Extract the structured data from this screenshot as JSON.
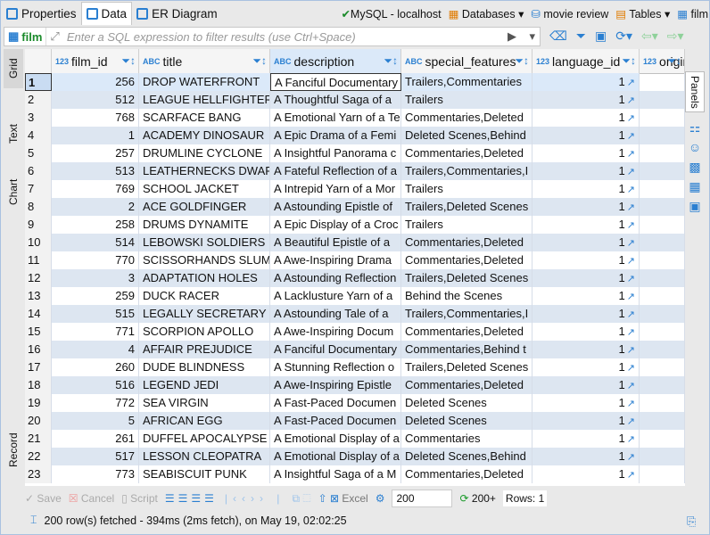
{
  "tabs": [
    {
      "label": "Properties"
    },
    {
      "label": "Data",
      "active": true
    },
    {
      "label": "ER Diagram"
    }
  ],
  "breadcrumb": {
    "connection": "MySQL - localhost",
    "databases": "Databases",
    "database": "movie review",
    "tables": "Tables",
    "table": "film"
  },
  "filter": {
    "table": "film",
    "placeholder": "Enter a SQL expression to filter results (use Ctrl+Space)"
  },
  "side_tabs": {
    "grid": "Grid",
    "text": "Text",
    "chart": "Chart",
    "record": "Record",
    "panels": "Panels"
  },
  "columns": [
    {
      "name": "film_id",
      "type": "123"
    },
    {
      "name": "title",
      "type": "ABC"
    },
    {
      "name": "description",
      "type": "ABC"
    },
    {
      "name": "special_features",
      "type": "ABC"
    },
    {
      "name": "language_id",
      "type": "123"
    },
    {
      "name": "original_language_id",
      "type": "123"
    }
  ],
  "rows": [
    [
      "1",
      "256",
      "DROP WATERFRONT",
      "A Fanciful Documentary",
      "Trailers,Commentaries",
      "1"
    ],
    [
      "2",
      "512",
      "LEAGUE HELLFIGHTERS",
      "A Thoughtful Saga of a",
      "Trailers",
      "1"
    ],
    [
      "3",
      "768",
      "SCARFACE BANG",
      "A Emotional Yarn of a Te",
      "Commentaries,Deleted",
      "1"
    ],
    [
      "4",
      "1",
      "ACADEMY DINOSAUR",
      "A Epic Drama of a Femi",
      "Deleted Scenes,Behind",
      "1"
    ],
    [
      "5",
      "257",
      "DRUMLINE CYCLONE",
      "A Insightful Panorama c",
      "Commentaries,Deleted",
      "1"
    ],
    [
      "6",
      "513",
      "LEATHERNECKS DWARFS",
      "A Fateful Reflection of a",
      "Trailers,Commentaries,I",
      "1"
    ],
    [
      "7",
      "769",
      "SCHOOL JACKET",
      "A Intrepid Yarn of a Mor",
      "Trailers",
      "1"
    ],
    [
      "8",
      "2",
      "ACE GOLDFINGER",
      "A Astounding Epistle of",
      "Trailers,Deleted Scenes",
      "1"
    ],
    [
      "9",
      "258",
      "DRUMS DYNAMITE",
      "A Epic Display of a Croc",
      "Trailers",
      "1"
    ],
    [
      "10",
      "514",
      "LEBOWSKI SOLDIERS",
      "A Beautiful Epistle of a",
      "Commentaries,Deleted",
      "1"
    ],
    [
      "11",
      "770",
      "SCISSORHANDS SLUM",
      "A Awe-Inspiring Drama",
      "Commentaries,Deleted",
      "1"
    ],
    [
      "12",
      "3",
      "ADAPTATION HOLES",
      "A Astounding Reflection",
      "Trailers,Deleted Scenes",
      "1"
    ],
    [
      "13",
      "259",
      "DUCK RACER",
      "A Lacklusture Yarn of a",
      "Behind the Scenes",
      "1"
    ],
    [
      "14",
      "515",
      "LEGALLY SECRETARY",
      "A Astounding Tale of a",
      "Trailers,Commentaries,I",
      "1"
    ],
    [
      "15",
      "771",
      "SCORPION APOLLO",
      "A Awe-Inspiring Docum",
      "Commentaries,Deleted",
      "1"
    ],
    [
      "16",
      "4",
      "AFFAIR PREJUDICE",
      "A Fanciful Documentary",
      "Commentaries,Behind t",
      "1"
    ],
    [
      "17",
      "260",
      "DUDE BLINDNESS",
      "A Stunning Reflection o",
      "Trailers,Deleted Scenes",
      "1"
    ],
    [
      "18",
      "516",
      "LEGEND JEDI",
      "A Awe-Inspiring Epistle",
      "Commentaries,Deleted",
      "1"
    ],
    [
      "19",
      "772",
      "SEA VIRGIN",
      "A Fast-Paced Documen",
      "Deleted Scenes",
      "1"
    ],
    [
      "20",
      "5",
      "AFRICAN EGG",
      "A Fast-Paced Documen",
      "Deleted Scenes",
      "1"
    ],
    [
      "21",
      "261",
      "DUFFEL APOCALYPSE",
      "A Emotional Display of a",
      "Commentaries",
      "1"
    ],
    [
      "22",
      "517",
      "LESSON CLEOPATRA",
      "A Emotional Display of a",
      "Deleted Scenes,Behind",
      "1"
    ],
    [
      "23",
      "773",
      "SEABISCUIT PUNK",
      "A Insightful Saga of a M",
      "Commentaries,Deleted",
      "1"
    ]
  ],
  "toolbar": {
    "save": "Save",
    "cancel": "Cancel",
    "script": "Script",
    "export": "Excel",
    "fetch_size": "200",
    "fetch_all": "200+",
    "rows": "Rows: 1"
  },
  "status": "200 row(s) fetched - 394ms (2ms fetch), on May 19, 02:02:25",
  "colors": {
    "accent": "#2a7fd1",
    "alt_row": "#dde6f1",
    "selected": "#c9dcf2"
  }
}
